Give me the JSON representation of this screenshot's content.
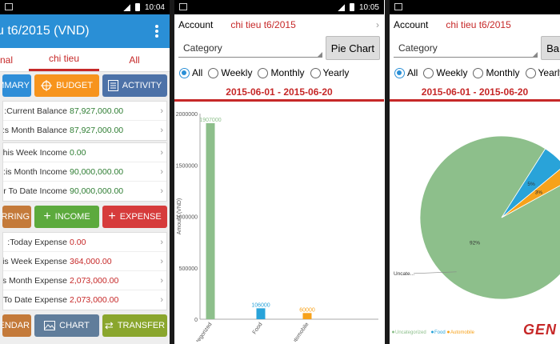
{
  "pane1": {
    "status_time": "10:04",
    "title": "u t6/2015 (VND)",
    "tabs": [
      "nal",
      "chi tieu",
      "All"
    ],
    "buttons_row1": [
      "MMARY",
      "BUDGET",
      "ACTIVITY"
    ],
    "balances": [
      {
        "label": "Current Balance:",
        "value": "87,927,000.00"
      },
      {
        "label": "s Month Balance:",
        "value": "87,927,000.00"
      }
    ],
    "incomes": [
      {
        "label": "his Week Income:",
        "value": "0.00"
      },
      {
        "label": "is Month Income:",
        "value": "90,000,000.00"
      },
      {
        "label": "r To Date Income:",
        "value": "90,000,000.00"
      }
    ],
    "buttons_row2": [
      "URRING",
      "INCOME",
      "EXPENSE"
    ],
    "expenses": [
      {
        "label": "Today Expense:",
        "value": "0.00"
      },
      {
        "label": "is Week Expense:",
        "value": "364,000.00"
      },
      {
        "label": "s Month Expense:",
        "value": "2,073,000.00"
      },
      {
        "label": "To Date Expense:",
        "value": "2,073,000.00"
      }
    ],
    "buttons_row3": [
      "ENDAR",
      "CHART",
      "TRANSFER"
    ]
  },
  "pane2": {
    "status_time": "10:05",
    "account_label": "Account",
    "account_value": "chi tieu t6/2015",
    "category_label": "Category",
    "pie_button": "Pie Chart",
    "radios": [
      "All",
      "Weekly",
      "Monthly",
      "Yearly"
    ],
    "date_range": "2015-06-01 - 2015-06-20"
  },
  "pane3": {
    "account_label": "Account",
    "account_value": "chi tieu t6/2015",
    "category_label": "Category",
    "button_partial": "Ba",
    "radios": [
      "All",
      "Weekly",
      "Monthly",
      "Yearly"
    ],
    "date_range": "2015-06-01 - 2015-06-20",
    "watermark": "GEN"
  },
  "colors": {
    "appbar": "#2a8fd6",
    "accent_red": "#c62828",
    "bar_green": "#8dbf8b",
    "bar_blue": "#29a3d9",
    "bar_orange": "#f7a21b"
  },
  "chart_data": [
    {
      "type": "bar",
      "categories": [
        "Uncategorized",
        "Food",
        "Automobile"
      ],
      "values": [
        1907000,
        106000,
        60000
      ],
      "value_labels": [
        "1907000",
        "106000",
        "60000"
      ],
      "ylabel": "Amount (VND)",
      "ylim": [
        0,
        2000000
      ],
      "yticks": [
        "0",
        "500000",
        "1000000",
        "1500000",
        "2000000"
      ],
      "colors": [
        "#8dbf8b",
        "#29a3d9",
        "#f7a21b"
      ]
    },
    {
      "type": "pie",
      "categories": [
        "Uncategorized",
        "Food",
        "Automobile"
      ],
      "values": [
        92,
        5,
        3
      ],
      "slice_labels": [
        "92%",
        "5%",
        "3%"
      ],
      "callout_label": "Uncate...",
      "legend": [
        "Uncategorized",
        "Food",
        "Automobile"
      ],
      "legend_position": "bottom-left",
      "colors": [
        "#8dbf8b",
        "#29a3d9",
        "#f7a21b"
      ]
    }
  ]
}
